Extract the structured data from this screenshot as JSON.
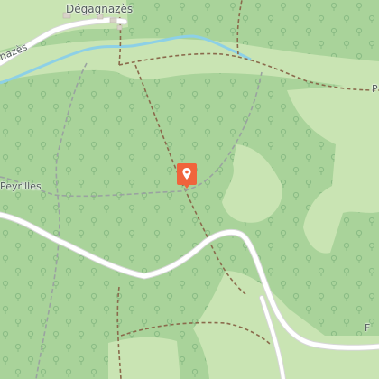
{
  "map": {
    "labels": {
      "village": "Dégagnazès",
      "west_edge": "nazès",
      "peyrilles": "Peyrilles",
      "east_edge": "P",
      "south_east_edge": "F"
    },
    "marker": {
      "icon": "location-pin-icon",
      "color": "#f0643c"
    },
    "colors": {
      "forest": "#a9d39a",
      "meadow": "#c9e4b3",
      "road": "#ffffff",
      "stream": "#8dd0e6",
      "trail": "#8a6a4c",
      "tree_symbol": "#89bb84"
    }
  }
}
